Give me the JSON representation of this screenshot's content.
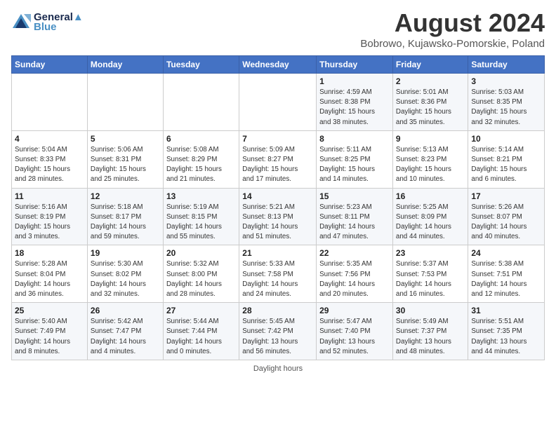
{
  "header": {
    "logo_line1": "General",
    "logo_line2": "Blue",
    "main_title": "August 2024",
    "subtitle": "Bobrowo, Kujawsko-Pomorskie, Poland"
  },
  "days_of_week": [
    "Sunday",
    "Monday",
    "Tuesday",
    "Wednesday",
    "Thursday",
    "Friday",
    "Saturday"
  ],
  "weeks": [
    [
      {
        "day": "",
        "info": ""
      },
      {
        "day": "",
        "info": ""
      },
      {
        "day": "",
        "info": ""
      },
      {
        "day": "",
        "info": ""
      },
      {
        "day": "1",
        "info": "Sunrise: 4:59 AM\nSunset: 8:38 PM\nDaylight: 15 hours\nand 38 minutes."
      },
      {
        "day": "2",
        "info": "Sunrise: 5:01 AM\nSunset: 8:36 PM\nDaylight: 15 hours\nand 35 minutes."
      },
      {
        "day": "3",
        "info": "Sunrise: 5:03 AM\nSunset: 8:35 PM\nDaylight: 15 hours\nand 32 minutes."
      }
    ],
    [
      {
        "day": "4",
        "info": "Sunrise: 5:04 AM\nSunset: 8:33 PM\nDaylight: 15 hours\nand 28 minutes."
      },
      {
        "day": "5",
        "info": "Sunrise: 5:06 AM\nSunset: 8:31 PM\nDaylight: 15 hours\nand 25 minutes."
      },
      {
        "day": "6",
        "info": "Sunrise: 5:08 AM\nSunset: 8:29 PM\nDaylight: 15 hours\nand 21 minutes."
      },
      {
        "day": "7",
        "info": "Sunrise: 5:09 AM\nSunset: 8:27 PM\nDaylight: 15 hours\nand 17 minutes."
      },
      {
        "day": "8",
        "info": "Sunrise: 5:11 AM\nSunset: 8:25 PM\nDaylight: 15 hours\nand 14 minutes."
      },
      {
        "day": "9",
        "info": "Sunrise: 5:13 AM\nSunset: 8:23 PM\nDaylight: 15 hours\nand 10 minutes."
      },
      {
        "day": "10",
        "info": "Sunrise: 5:14 AM\nSunset: 8:21 PM\nDaylight: 15 hours\nand 6 minutes."
      }
    ],
    [
      {
        "day": "11",
        "info": "Sunrise: 5:16 AM\nSunset: 8:19 PM\nDaylight: 15 hours\nand 3 minutes."
      },
      {
        "day": "12",
        "info": "Sunrise: 5:18 AM\nSunset: 8:17 PM\nDaylight: 14 hours\nand 59 minutes."
      },
      {
        "day": "13",
        "info": "Sunrise: 5:19 AM\nSunset: 8:15 PM\nDaylight: 14 hours\nand 55 minutes."
      },
      {
        "day": "14",
        "info": "Sunrise: 5:21 AM\nSunset: 8:13 PM\nDaylight: 14 hours\nand 51 minutes."
      },
      {
        "day": "15",
        "info": "Sunrise: 5:23 AM\nSunset: 8:11 PM\nDaylight: 14 hours\nand 47 minutes."
      },
      {
        "day": "16",
        "info": "Sunrise: 5:25 AM\nSunset: 8:09 PM\nDaylight: 14 hours\nand 44 minutes."
      },
      {
        "day": "17",
        "info": "Sunrise: 5:26 AM\nSunset: 8:07 PM\nDaylight: 14 hours\nand 40 minutes."
      }
    ],
    [
      {
        "day": "18",
        "info": "Sunrise: 5:28 AM\nSunset: 8:04 PM\nDaylight: 14 hours\nand 36 minutes."
      },
      {
        "day": "19",
        "info": "Sunrise: 5:30 AM\nSunset: 8:02 PM\nDaylight: 14 hours\nand 32 minutes."
      },
      {
        "day": "20",
        "info": "Sunrise: 5:32 AM\nSunset: 8:00 PM\nDaylight: 14 hours\nand 28 minutes."
      },
      {
        "day": "21",
        "info": "Sunrise: 5:33 AM\nSunset: 7:58 PM\nDaylight: 14 hours\nand 24 minutes."
      },
      {
        "day": "22",
        "info": "Sunrise: 5:35 AM\nSunset: 7:56 PM\nDaylight: 14 hours\nand 20 minutes."
      },
      {
        "day": "23",
        "info": "Sunrise: 5:37 AM\nSunset: 7:53 PM\nDaylight: 14 hours\nand 16 minutes."
      },
      {
        "day": "24",
        "info": "Sunrise: 5:38 AM\nSunset: 7:51 PM\nDaylight: 14 hours\nand 12 minutes."
      }
    ],
    [
      {
        "day": "25",
        "info": "Sunrise: 5:40 AM\nSunset: 7:49 PM\nDaylight: 14 hours\nand 8 minutes."
      },
      {
        "day": "26",
        "info": "Sunrise: 5:42 AM\nSunset: 7:47 PM\nDaylight: 14 hours\nand 4 minutes."
      },
      {
        "day": "27",
        "info": "Sunrise: 5:44 AM\nSunset: 7:44 PM\nDaylight: 14 hours\nand 0 minutes."
      },
      {
        "day": "28",
        "info": "Sunrise: 5:45 AM\nSunset: 7:42 PM\nDaylight: 13 hours\nand 56 minutes."
      },
      {
        "day": "29",
        "info": "Sunrise: 5:47 AM\nSunset: 7:40 PM\nDaylight: 13 hours\nand 52 minutes."
      },
      {
        "day": "30",
        "info": "Sunrise: 5:49 AM\nSunset: 7:37 PM\nDaylight: 13 hours\nand 48 minutes."
      },
      {
        "day": "31",
        "info": "Sunrise: 5:51 AM\nSunset: 7:35 PM\nDaylight: 13 hours\nand 44 minutes."
      }
    ]
  ],
  "footer": {
    "text": "Daylight hours"
  }
}
